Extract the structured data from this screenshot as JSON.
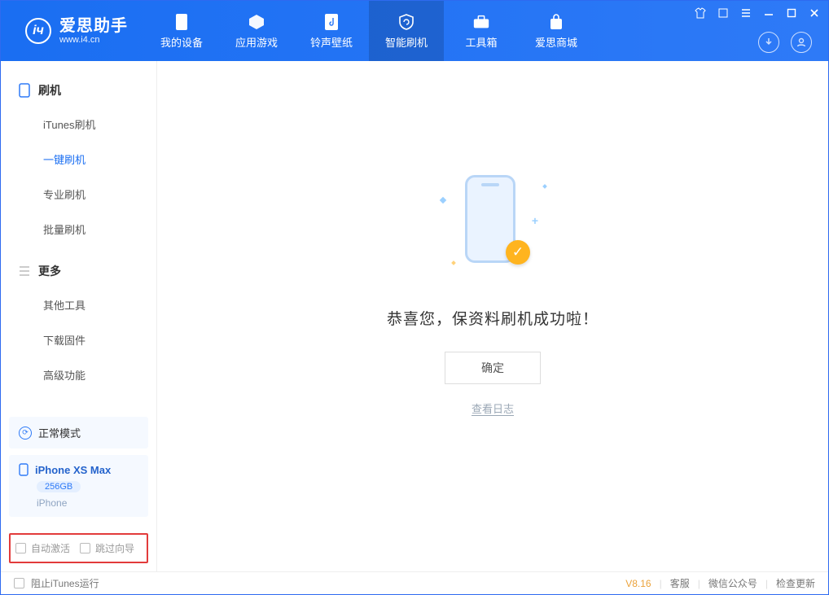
{
  "app": {
    "title": "爱思助手",
    "subtitle": "www.i4.cn"
  },
  "nav": {
    "device": "我的设备",
    "apps": "应用游戏",
    "ringtones": "铃声壁纸",
    "flash": "智能刷机",
    "toolbox": "工具箱",
    "store": "爱思商城"
  },
  "sidebar": {
    "section1_title": "刷机",
    "items1": {
      "itunes": "iTunes刷机",
      "oneclick": "一键刷机",
      "pro": "专业刷机",
      "batch": "批量刷机"
    },
    "section2_title": "更多",
    "items2": {
      "other_tools": "其他工具",
      "download_fw": "下载固件",
      "advanced": "高级功能"
    }
  },
  "mode": {
    "label": "正常模式"
  },
  "device": {
    "name": "iPhone XS Max",
    "storage": "256GB",
    "type": "iPhone"
  },
  "options": {
    "auto_activate": "自动激活",
    "skip_guide": "跳过向导"
  },
  "main": {
    "success_text": "恭喜您，保资料刷机成功啦！",
    "ok_btn": "确定",
    "log_link": "查看日志"
  },
  "footer": {
    "block_itunes": "阻止iTunes运行",
    "version": "V8.16",
    "support": "客服",
    "wechat": "微信公众号",
    "check_update": "检查更新"
  }
}
